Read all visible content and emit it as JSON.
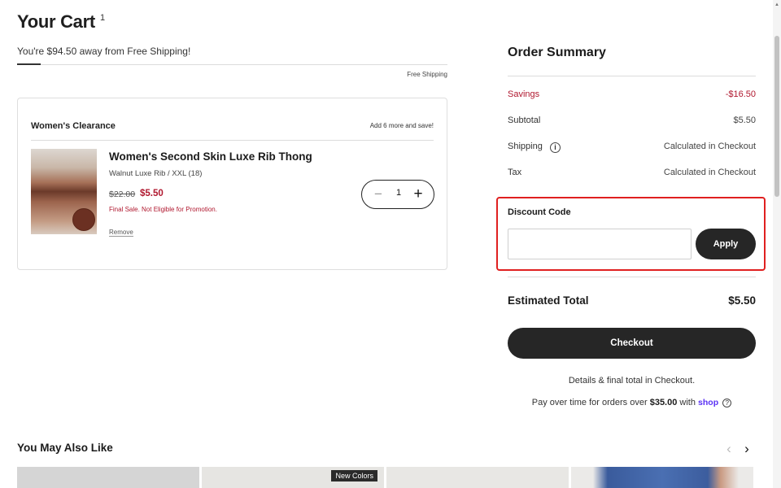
{
  "cart": {
    "title": "Your Cart",
    "count": "1",
    "shipping_message": "You're $94.50 away from Free Shipping!",
    "free_shipping_label": "Free Shipping",
    "shipping_progress_fraction": 0.055
  },
  "card": {
    "section_title": "Women's Clearance",
    "promo_text": "Add 6 more and save!",
    "item": {
      "name": "Women's Second Skin Luxe Rib Thong",
      "variant": "Walnut Luxe Rib / XXL (18)",
      "price_original": "$22.00",
      "price_sale": "$5.50",
      "notice": "Final Sale. Not Eligible for Promotion.",
      "remove_label": "Remove",
      "quantity": "1",
      "minus_symbol": "−",
      "plus_symbol": "+",
      "image_icon": "product-photo",
      "swatch_color": "#6b3022"
    }
  },
  "summary": {
    "title": "Order Summary",
    "rows": [
      {
        "label": "Savings",
        "value": "-$16.50"
      },
      {
        "label": "Subtotal",
        "value": "$5.50"
      },
      {
        "label": "Shipping",
        "value": "Calculated in Checkout"
      },
      {
        "label": "Tax",
        "value": "Calculated in Checkout"
      }
    ],
    "info_symbol": "i",
    "discount": {
      "label": "Discount Code",
      "value": "",
      "placeholder": "",
      "apply_label": "Apply"
    },
    "estimated_total_label": "Estimated Total",
    "estimated_total_value": "$5.50",
    "checkout_label": "Checkout",
    "details_note": "Details & final total in Checkout.",
    "pay_note_prefix": "Pay over time for orders over",
    "pay_note_amount": "$35.00",
    "pay_note_with": "with",
    "pay_brand": "shop",
    "help_symbol": "?"
  },
  "recommendations": {
    "title": "You May Also Like",
    "prev_symbol": "‹",
    "next_symbol": "›",
    "badge": "New Colors"
  },
  "colors": {
    "sale_red": "#b0182f",
    "button_dark": "#262626",
    "highlight_red": "#e02020",
    "shop_purple": "#5a31f4"
  }
}
